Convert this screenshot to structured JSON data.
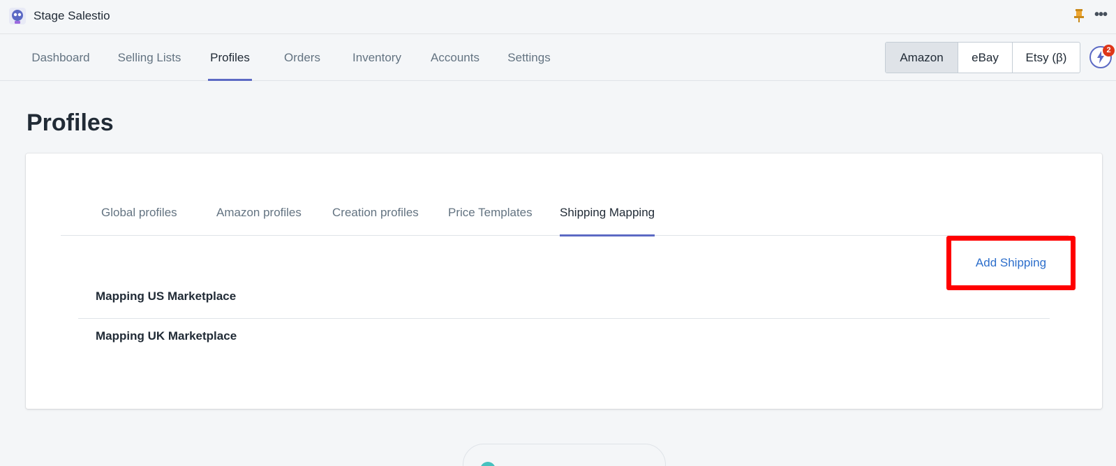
{
  "app": {
    "title": "Stage Salestio",
    "logo_icon": "robot-logo-icon"
  },
  "appbar_icons": {
    "pin": "pin-icon",
    "more": "•••"
  },
  "nav": {
    "items": [
      "Dashboard",
      "Selling Lists",
      "Profiles",
      "Orders",
      "Inventory",
      "Accounts",
      "Settings"
    ],
    "active": "Profiles"
  },
  "marketplaces": {
    "items": [
      "Amazon",
      "eBay",
      "Etsy (β)"
    ],
    "active": "Amazon"
  },
  "notifications": {
    "icon": "lightning-icon",
    "count": "2"
  },
  "page": {
    "title": "Profiles"
  },
  "tabs": {
    "items": [
      "Global profiles",
      "Amazon profiles",
      "Creation profiles",
      "Price Templates",
      "Shipping Mapping"
    ],
    "active": "Shipping Mapping"
  },
  "actions": {
    "add_shipping": "Add Shipping"
  },
  "list": {
    "items": [
      "Mapping US Marketplace",
      "Mapping UK Marketplace"
    ]
  },
  "colors": {
    "accent": "#5c6ac4",
    "link": "#2c6ecb",
    "highlight": "#ff0000",
    "badge": "#de3618"
  }
}
